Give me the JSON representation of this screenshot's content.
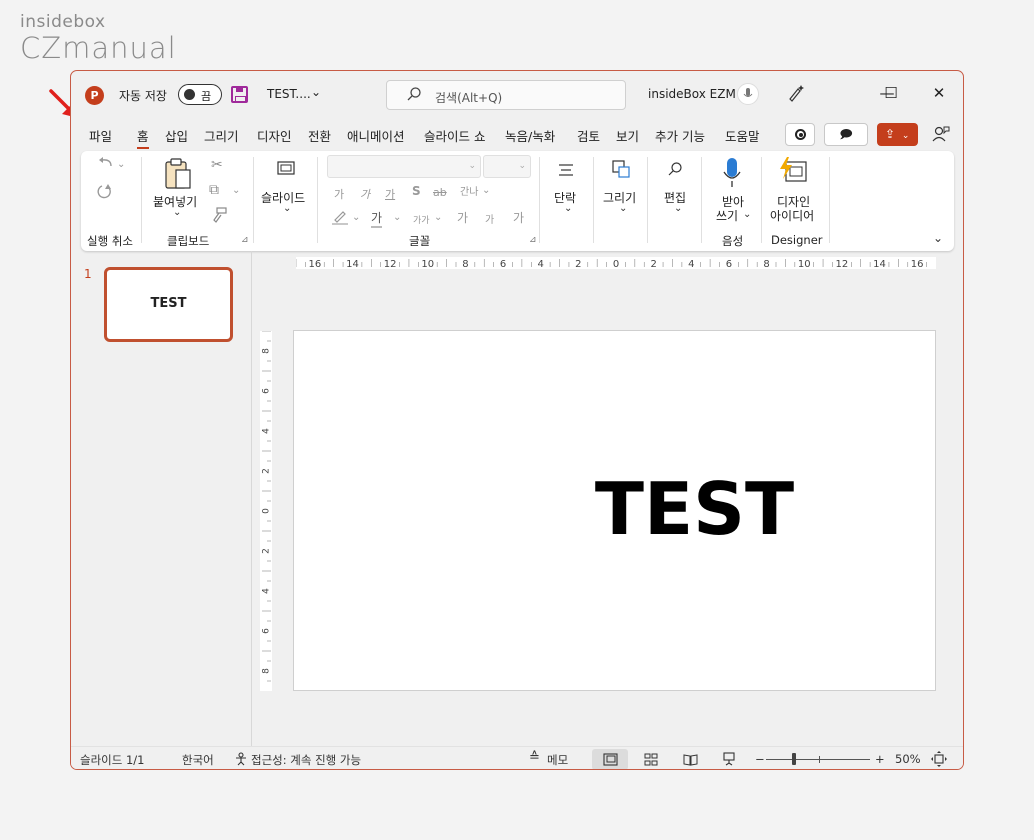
{
  "watermark": {
    "line1": "insidebox",
    "line2": "CZmanual"
  },
  "titlebar": {
    "app_icon": "P",
    "autosave_label": "자동 저장",
    "autosave_state": "끔",
    "doc_title": "TEST....",
    "doc_chevron": "⌄",
    "search_placeholder": "검색(Alt+Q)",
    "user_name": "insideBox EZM",
    "minimize": "—",
    "maximize": "☐",
    "close": "✕"
  },
  "menu": {
    "tabs": [
      "파일",
      "홈",
      "삽입",
      "그리기",
      "디자인",
      "전환",
      "애니메이션",
      "슬라이드 쇼",
      "녹음/녹화",
      "검토",
      "보기",
      "추가 기능",
      "도움말"
    ],
    "active_tab": "홈",
    "comment_icon": "🗩",
    "share_icon": "⇪",
    "share_chevron": "⌄"
  },
  "ribbon": {
    "undo_group": "실행 취소",
    "clipboard": {
      "paste": "붙여넣기",
      "label": "클립보드"
    },
    "slides": {
      "label": "슬라이드"
    },
    "font": {
      "label": "글꼴",
      "ga1": "가",
      "ga2": "가",
      "ga_underline": "가",
      "s": "S",
      "abc": "ab",
      "spacing": "간나",
      "ga_color": "가",
      "ga_size": "가가",
      "ga_up": "가",
      "ga_down": "가",
      "ga_clear": "가"
    },
    "paragraph": {
      "label": "단락"
    },
    "drawing": {
      "label": "그리기"
    },
    "editing": {
      "label": "편집"
    },
    "dictate": {
      "line1": "받아",
      "line2": "쓰기",
      "group": "음성"
    },
    "designer": {
      "line1": "디자인",
      "line2": "아이디어",
      "group": "Designer"
    }
  },
  "ruler": {
    "h_labels": [
      "16",
      "14",
      "12",
      "10",
      "8",
      "6",
      "4",
      "2",
      "0",
      "2",
      "4",
      "6",
      "8",
      "10",
      "12",
      "14",
      "16"
    ],
    "v_labels": [
      "8",
      "6",
      "4",
      "2",
      "0",
      "2",
      "4",
      "6",
      "8"
    ]
  },
  "thumbnails": [
    {
      "number": "1",
      "text": "TEST"
    }
  ],
  "slide": {
    "title": "TEST"
  },
  "statusbar": {
    "slide_count": "슬라이드 1/1",
    "language": "한국어",
    "accessibility": "접근성: 계속 진행 가능",
    "notes": "메모",
    "zoom_minus": "−",
    "zoom_plus": "+",
    "zoom_level": "50%"
  },
  "colors": {
    "accent": "#c43e1c",
    "window_border": "#c75b45",
    "autosave_icon": "#a02a9b"
  }
}
